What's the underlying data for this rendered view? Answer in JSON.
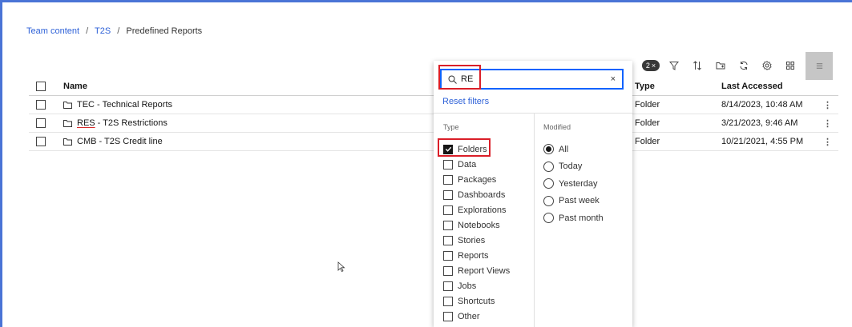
{
  "breadcrumb": {
    "root": "Team content",
    "parent": "T2S",
    "current": "Predefined Reports",
    "separator": "/"
  },
  "toolbar": {
    "filter_count": "2",
    "filter_count_close": "×"
  },
  "table": {
    "headers": {
      "name": "Name",
      "type": "Type",
      "last_accessed": "Last Accessed"
    },
    "rows": [
      {
        "code": "TEC",
        "title": " - Technical Reports",
        "type": "Folder",
        "accessed": "8/14/2023, 10:48 AM"
      },
      {
        "code": "RES",
        "title": " - T2S Restrictions",
        "type": "Folder",
        "accessed": "3/21/2023, 9:46 AM"
      },
      {
        "code": "CMB",
        "title": " - T2S Credit line",
        "type": "Folder",
        "accessed": "10/21/2021, 4:55 PM"
      }
    ],
    "kebab": "⋮"
  },
  "filter_panel": {
    "search_value": "RE",
    "clear": "×",
    "reset_label": "Reset filters",
    "type_title": "Type",
    "modified_title": "Modified",
    "types": [
      {
        "label": "Folders",
        "checked": true
      },
      {
        "label": "Data",
        "checked": false
      },
      {
        "label": "Packages",
        "checked": false
      },
      {
        "label": "Dashboards",
        "checked": false
      },
      {
        "label": "Explorations",
        "checked": false
      },
      {
        "label": "Notebooks",
        "checked": false
      },
      {
        "label": "Stories",
        "checked": false
      },
      {
        "label": "Reports",
        "checked": false
      },
      {
        "label": "Report Views",
        "checked": false
      },
      {
        "label": "Jobs",
        "checked": false
      },
      {
        "label": "Shortcuts",
        "checked": false
      },
      {
        "label": "Other",
        "checked": false
      }
    ],
    "modified": [
      {
        "label": "All",
        "selected": true
      },
      {
        "label": "Today",
        "selected": false
      },
      {
        "label": "Yesterday",
        "selected": false
      },
      {
        "label": "Past week",
        "selected": false
      },
      {
        "label": "Past month",
        "selected": false
      }
    ]
  },
  "colors": {
    "link": "#2f62d8",
    "highlight": "#da1e28",
    "focus": "#0f62fe"
  }
}
